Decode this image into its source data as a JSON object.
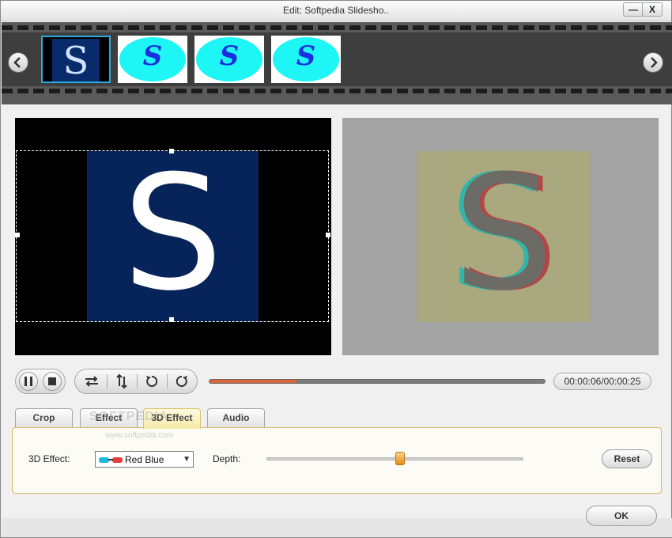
{
  "window": {
    "title": "Edit: Softpedia Slidesho..",
    "min_label": "—",
    "close_label": "X"
  },
  "filmstrip": {
    "prev_icon": "chevron-left-icon",
    "next_icon": "chevron-right-icon",
    "thumbnails": [
      {
        "letter": "S",
        "selected": true
      },
      {
        "letter": "S",
        "selected": false
      },
      {
        "letter": "S",
        "selected": false
      },
      {
        "letter": "S",
        "selected": false
      }
    ]
  },
  "preview": {
    "original_letter": "S",
    "output_letter": "S"
  },
  "controls": {
    "pause_icon": "pause-icon",
    "stop_icon": "stop-icon",
    "flip_horizontal_icon": "flip-horizontal-icon",
    "flip_vertical_icon": "flip-vertical-icon",
    "rotate_left_icon": "rotate-left-icon",
    "rotate_right_icon": "rotate-right-icon",
    "progress_fraction": 0.26,
    "time": "00:00:06/00:00:25"
  },
  "tabs": [
    {
      "label": "Crop",
      "active": false
    },
    {
      "label": "Effect",
      "active": false
    },
    {
      "label": "3D Effect",
      "active": true
    },
    {
      "label": "Audio",
      "active": false
    }
  ],
  "effect3d": {
    "effect_label": "3D Effect:",
    "effect_value": "Red Blue",
    "depth_label": "Depth:",
    "depth_fraction": 0.52,
    "reset_label": "Reset"
  },
  "footer": {
    "ok_label": "OK"
  },
  "watermark": {
    "text": "SOFTPEDIA",
    "sub": "www.softpedia.com"
  },
  "colors": {
    "accent": "#d9663a",
    "tab_active": "#f5e9a8",
    "selection": "#2aa8e0"
  }
}
